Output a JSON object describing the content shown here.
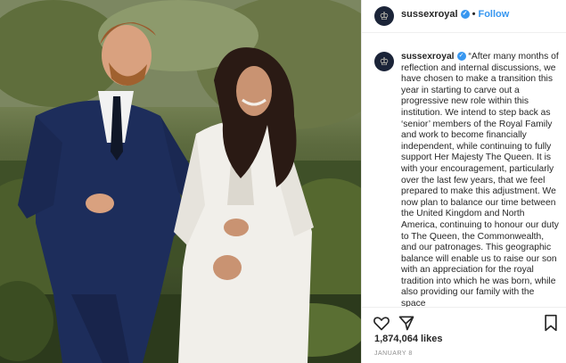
{
  "post": {
    "username": "sussexroyal",
    "follow_label": "Follow",
    "separator": "•",
    "avatar_glyph": "♔",
    "caption": "“After many months of reflection and internal discussions, we have chosen to make a transition this year in starting to carve out a progressive new role within this institution. We intend to step back as ‘senior’ members of the Royal Family and work to become financially independent, while continuing to fully support Her Majesty The Queen. It is with your encouragement, particularly over the last few years, that we feel prepared to make this adjustment. We now plan to balance our time between the United Kingdom and North America, continuing to honour our duty to The Queen, the Commonwealth, and our patronages. This geographic balance will enable us to raise our son with an appreciation for the royal tradition into which he was born, while also providing our family with the space",
    "likes": "1,874,064 likes",
    "date": "JANUARY 8"
  },
  "icons": {
    "verified": "verified-badge-icon",
    "like": "heart-icon",
    "share": "paper-plane-icon",
    "save": "bookmark-icon"
  },
  "colors": {
    "accent": "#3897f0",
    "text": "#262626",
    "muted": "#8e8e8e"
  }
}
